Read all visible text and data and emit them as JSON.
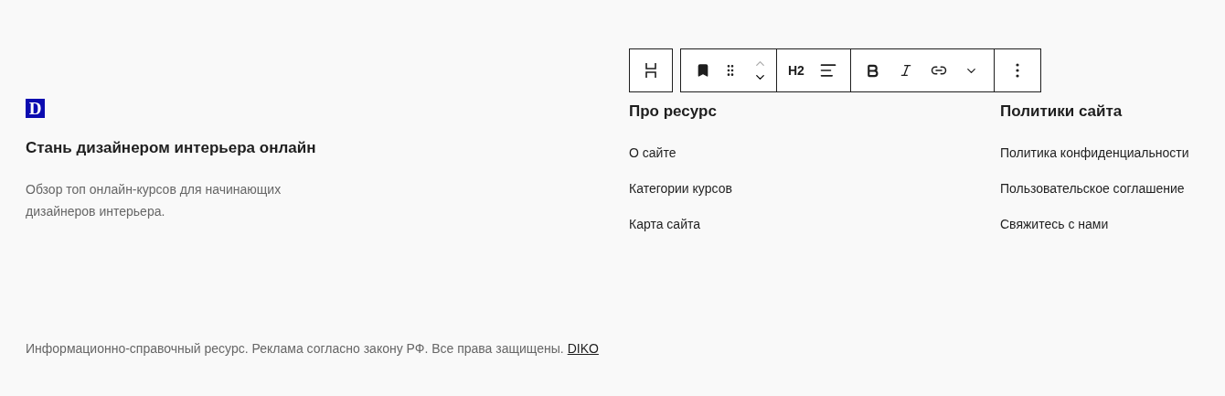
{
  "brand": {
    "logo": "D",
    "title": "Стань дизайнером интерьера онлайн",
    "description": "Обзор топ  онлайн-курсов для начинающих дизайнеров интерьера."
  },
  "toolbar": {
    "heading_level": "H2"
  },
  "columns": [
    {
      "title": "Про ресурс",
      "links": [
        "О сайте",
        "Категории курсов",
        "Карта сайта"
      ]
    },
    {
      "title": "Политики сайта",
      "links": [
        "Политика конфиденциальности",
        "Пользовательское соглашение",
        "Свяжитесь с нами"
      ]
    }
  ],
  "footer": {
    "text": "Информационно-справочный ресурс. Реклама согласно закону РФ. Все права защищены.",
    "link": "DIKO"
  }
}
